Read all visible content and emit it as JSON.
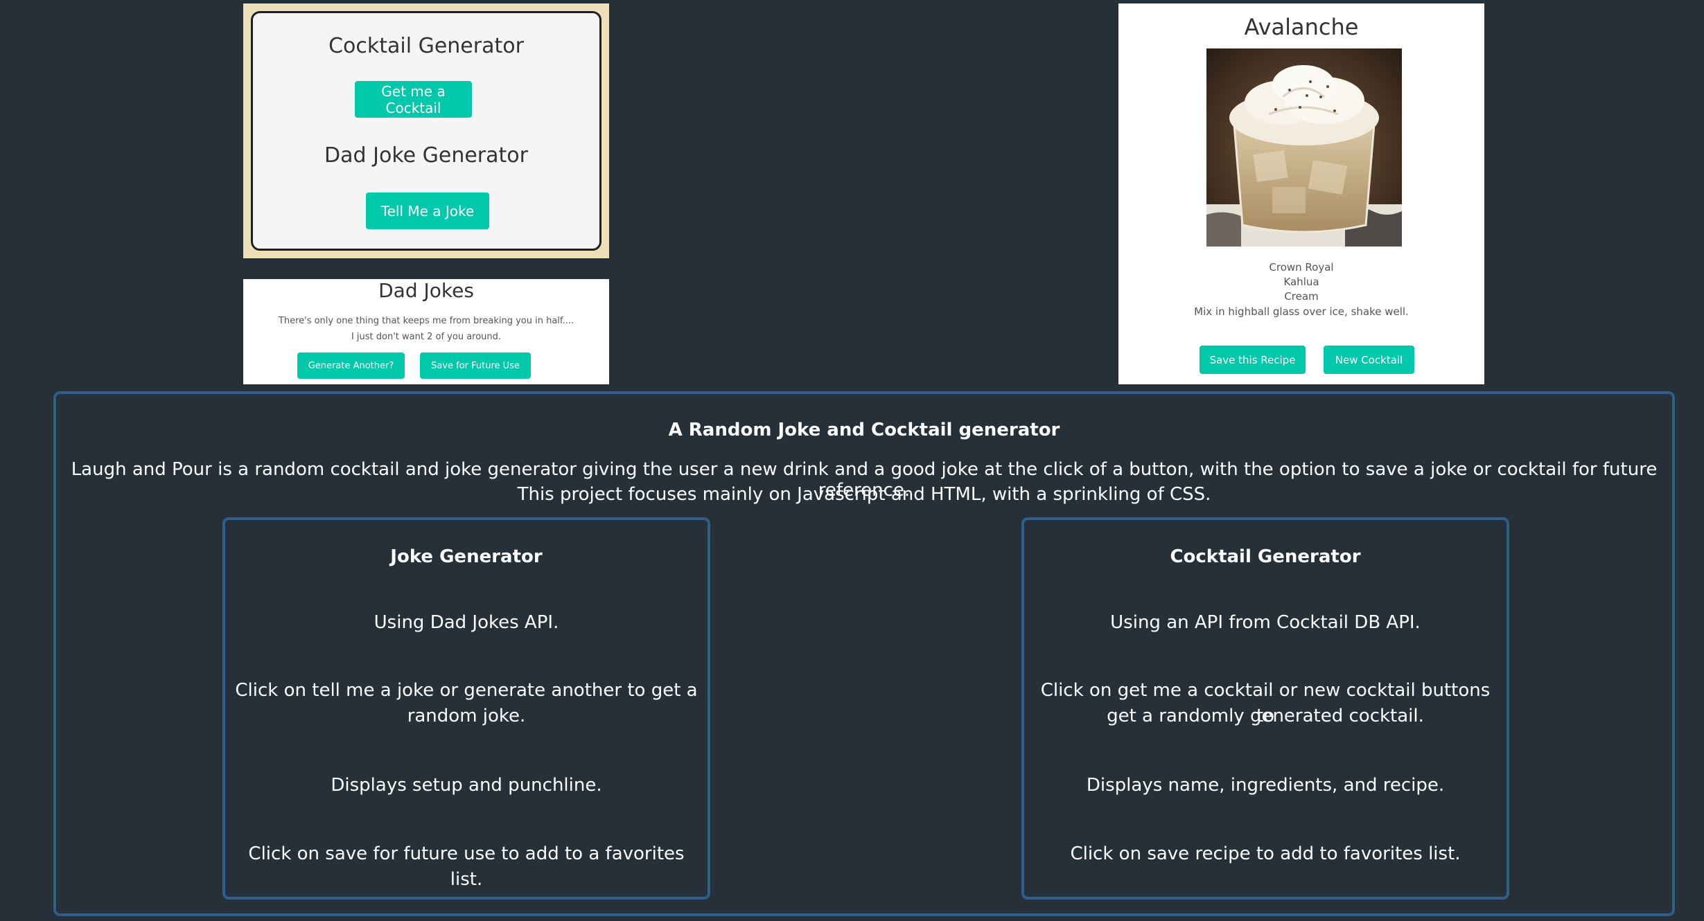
{
  "generator_card": {
    "cocktail_title": "Cocktail Generator",
    "cocktail_button": "Get me a Cocktail",
    "joke_title": "Dad Joke Generator",
    "joke_button": "Tell Me a Joke"
  },
  "joke_card": {
    "title": "Dad Jokes",
    "setup": "There's only one thing that keeps me from breaking you in half....",
    "punchline": "I just don't want 2 of you around.",
    "generate_button": "Generate Another?",
    "save_button": "Save for Future Use"
  },
  "cocktail_card": {
    "name": "Avalanche",
    "ingredients": [
      "Crown Royal",
      "Kahlua",
      "Cream"
    ],
    "instructions": "Mix in highball glass over ice, shake well.",
    "save_button": "Save this Recipe",
    "new_button": "New Cocktail"
  },
  "description": {
    "heading": "A Random Joke and Cocktail generator",
    "paragraph_line1": "Laugh and Pour is a random cocktail and joke generator giving the user a new drink and a good joke at the click of a button, with the option to save a joke or cocktail for future reference.",
    "paragraph_line2": "This project focuses mainly on Javascript and HTML, with a sprinkling of CSS.",
    "joke_feature": {
      "title": "Joke Generator",
      "api": "Using Dad Jokes API.",
      "click_line1": "Click on tell me a joke or generate another to get a",
      "click_line2": "random joke.",
      "display": "Displays setup and punchline.",
      "save": "Click on save for future use to add to a favorites list."
    },
    "cocktail_feature": {
      "title": "Cocktail Generator",
      "api": "Using an API from Cocktail DB API.",
      "click_line1": "Click on get me a cocktail or new cocktail buttons to",
      "click_line2": "get a randomly generated cocktail.",
      "display": "Displays name, ingredients, and recipe.",
      "save": "Click on save recipe to add to favorites list."
    }
  },
  "colors": {
    "background": "#253038",
    "accent": "#00c8aa",
    "panel_border": "#2f5e8c",
    "card_frame": "#ede0b9"
  }
}
